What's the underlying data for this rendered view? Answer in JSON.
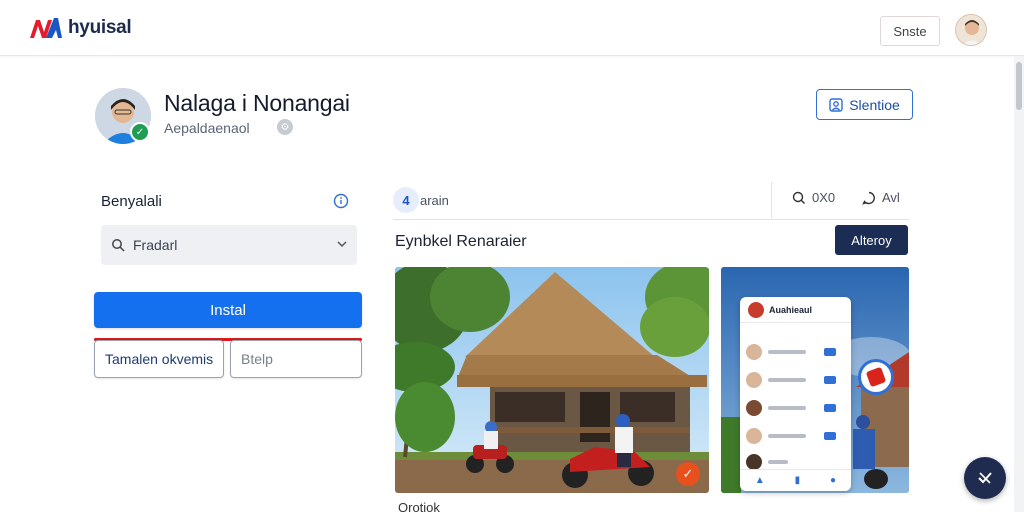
{
  "header": {
    "logo_text": "hyuisal",
    "top_button_label": "Snste"
  },
  "profile": {
    "name": "Nalaga i Nonangai",
    "subtitle": "Aepaldaenaol",
    "follow_button_label": "Slentioe"
  },
  "left_panel": {
    "title": "Benyalali",
    "select_value": "Fradarl",
    "primary_button_label": "Instal",
    "secondary_button_1_label": "Tamalen okvemis",
    "secondary_button_2_label": "Btelp"
  },
  "feed": {
    "tab_count": "4",
    "tab_label": "arain",
    "action_1_label": "0X0",
    "action_2_label": "Avl",
    "section_title": "Eynbkel Renaraier",
    "action_button_label": "Alteroy",
    "photo_caption": "Qrotiok",
    "phone_card": {
      "app_title": "Auahieaul"
    }
  },
  "colors": {
    "primary_blue": "#1570ef",
    "dark_navy": "#1c2d55",
    "accent_red": "#d71a1a",
    "verified_green": "#1f9d55"
  },
  "icons": [
    "logo-mark-icon",
    "profile-avatar-icon",
    "verified-icon",
    "info-icon",
    "search-icon",
    "chevron-down-icon",
    "user-icon",
    "comment-icon",
    "chat-icon",
    "check-badge-icon",
    "fab-icon"
  ]
}
